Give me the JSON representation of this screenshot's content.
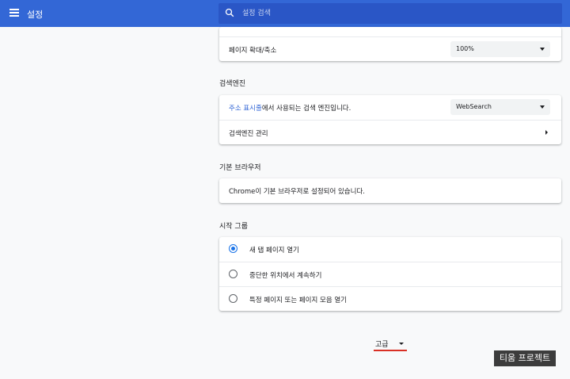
{
  "topbar": {
    "title": "설정",
    "menu_icon": "hamburger-menu-icon",
    "search_icon": "search-icon",
    "search_placeholder": "설정 검색",
    "color": "#3367d6"
  },
  "page_zoom": {
    "label": "페이지 확대/축소",
    "value": "100%"
  },
  "search_engine": {
    "section_title": "검색엔진",
    "address_bar_link": "주소 표시줄",
    "address_bar_rest": "에서 사용되는 검색 엔진입니다.",
    "engine_value": "WebSearch",
    "manage_label": "검색엔진 관리"
  },
  "default_browser": {
    "section_title": "기본 브라우저",
    "status": "Chrome이 기본 브라우저로 설정되어 있습니다."
  },
  "startup": {
    "section_title": "시작 그룹",
    "options": [
      {
        "label": "새 탭 페이지 열기",
        "selected": true
      },
      {
        "label": "중단한 위치에서 계속하기",
        "selected": false
      },
      {
        "label": "특정 페이지 또는 페이지 모음 열기",
        "selected": false
      }
    ]
  },
  "advanced": {
    "label": "고급"
  },
  "watermark": "티움 프로젝트"
}
